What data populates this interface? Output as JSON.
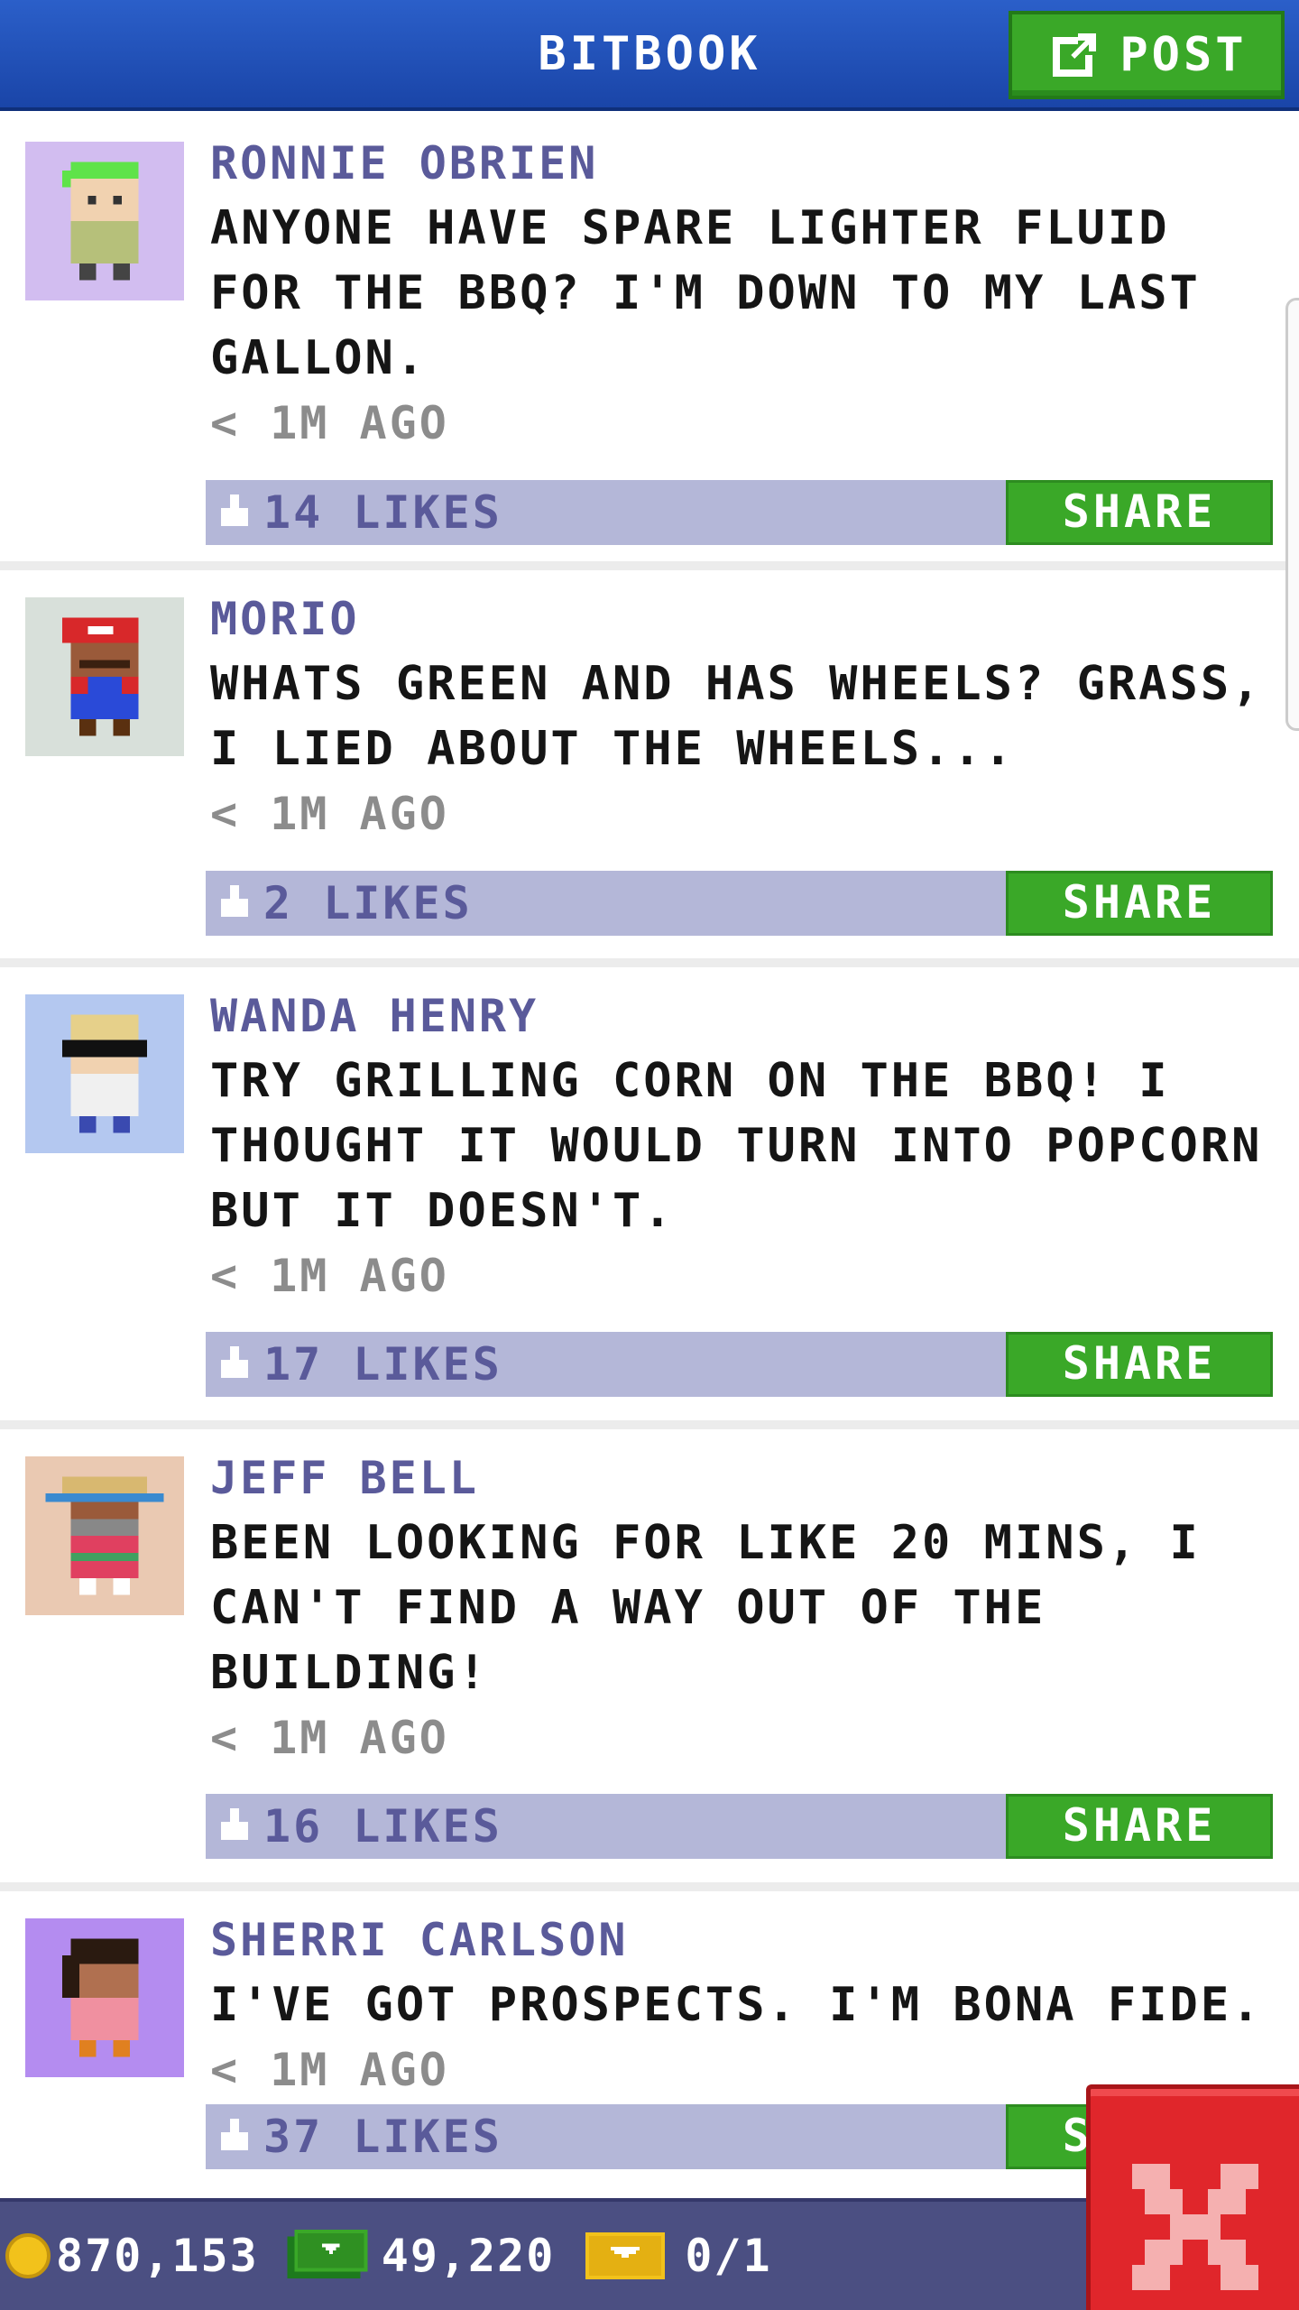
{
  "header": {
    "title": "BITBOOK",
    "post_label": "POST"
  },
  "posts": [
    {
      "author": "RONNIE OBRIEN",
      "message": "ANYONE HAVE SPARE LIGHTER FLUID FOR THE BBQ? I'M DOWN TO MY LAST GALLON.",
      "time": "< 1M AGO",
      "likes": "14 LIKES",
      "share": "SHARE",
      "avatar_bg": "#d2bdf0"
    },
    {
      "author": "MORIO",
      "message": "WHATS GREEN AND HAS WHEELS? GRASS, I LIED ABOUT THE WHEELS...",
      "time": "< 1M AGO",
      "likes": "2 LIKES",
      "share": "SHARE",
      "avatar_bg": "#d8e0da"
    },
    {
      "author": "WANDA HENRY",
      "message": "TRY GRILLING CORN ON THE BBQ! I THOUGHT IT WOULD TURN INTO POPCORN BUT IT DOESN'T.",
      "time": "< 1M AGO",
      "likes": "17 LIKES",
      "share": "SHARE",
      "avatar_bg": "#b4c8f0"
    },
    {
      "author": "JEFF BELL",
      "message": "BEEN LOOKING FOR LIKE 20 MINS, I CAN'T FIND A WAY OUT OF THE BUILDING!",
      "time": "< 1M AGO",
      "likes": "16 LIKES",
      "share": "SHARE",
      "avatar_bg": "#eac9b2"
    },
    {
      "author": "SHERRI CARLSON",
      "message": "I'VE GOT PROSPECTS. I'M BONA FIDE.",
      "time": "< 1M AGO",
      "likes": "37 LIKES",
      "share": "SHARE",
      "avatar_bg": "#b48cf0"
    }
  ],
  "footer": {
    "coins": "870,153",
    "bux": "49,220",
    "tickets": "0/1"
  },
  "colors": {
    "header_blue": "#2b5fc9",
    "share_green": "#3aa828",
    "bar_lavender": "#b4b7d8",
    "author_purple": "#5a5a9a",
    "close_red": "#e0262b"
  }
}
